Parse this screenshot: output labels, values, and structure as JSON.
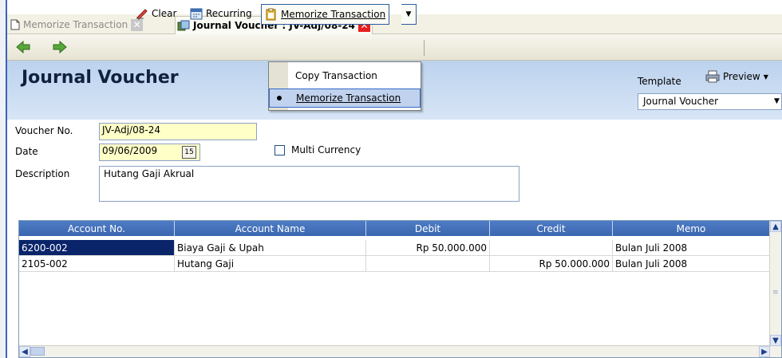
{
  "tabs": [
    {
      "label": "Memorize Transaction",
      "active": false
    },
    {
      "label": "Journal Voucher : JV-Adj/08-24",
      "active": true
    }
  ],
  "toolbar": {
    "clear_label": "Clear",
    "recurring_label": "Recurring",
    "memorize_label": "Memorize Transaction"
  },
  "menu": {
    "items": [
      {
        "label": "Copy Transaction",
        "selected": false
      },
      {
        "label": "Memorize Transaction",
        "selected": true
      }
    ]
  },
  "header": {
    "title": "Journal Voucher",
    "template_label": "Template",
    "preview_label": "Preview",
    "template_value": "Journal Voucher"
  },
  "form": {
    "voucher_label": "Voucher No.",
    "voucher_value": "JV-Adj/08-24",
    "date_label": "Date",
    "date_value": "09/06/2009",
    "calendar_text": "15",
    "multi_currency_label": "Multi Currency",
    "multi_currency_checked": false,
    "description_label": "Description",
    "description_value": "Hutang Gaji Akrual"
  },
  "grid": {
    "columns": [
      "Account No.",
      "Account Name",
      "Debit",
      "Credit",
      "Memo"
    ],
    "rows": [
      [
        "6200-002",
        "Biaya Gaji & Upah",
        "Rp 50.000.000",
        "",
        "Bulan Juli 2008"
      ],
      [
        "2105-002",
        "Hutang Gaji",
        "",
        "Rp 50.000.000",
        "Bulan Juli 2008"
      ]
    ]
  },
  "colors": {
    "header_band": "#c8daf1",
    "grid_header": "#4a76c0",
    "selection": "#0a246a",
    "close_active": "#e61e1e"
  }
}
